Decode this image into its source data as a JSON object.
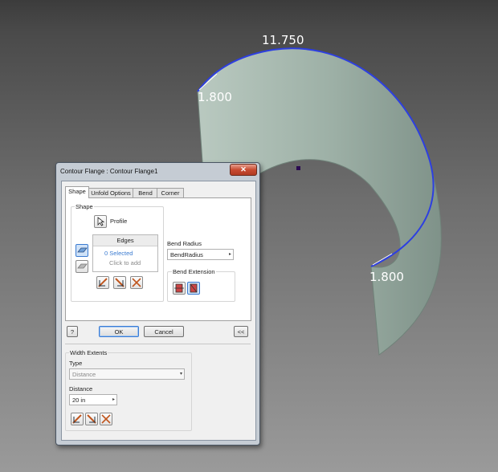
{
  "viewport": {
    "dimension_top": "11.750",
    "dimension_left": "1.800",
    "dimension_right": "1.800"
  },
  "dialog": {
    "title": "Contour Flange : Contour Flange1",
    "close_glyph": "✕",
    "tabs": [
      "Shape",
      "Unfold Options",
      "Bend",
      "Corner"
    ],
    "shape_group_label": "Shape",
    "profile_label": "Profile",
    "edges_header": "Edges",
    "edges_selected": "0 Selected",
    "edges_hint": "Click to add",
    "bend_radius_label": "Bend Radius",
    "bend_radius_value": "BendRadius",
    "bend_extension_label": "Bend Extension",
    "help_glyph": "?",
    "ok_label": "OK",
    "cancel_label": "Cancel",
    "collapse_label": "<<",
    "width_extents_label": "Width Extents",
    "type_label": "Type",
    "type_value": "Distance",
    "distance_label": "Distance",
    "distance_value": "20 in",
    "colors": {
      "accent_blue": "#3b7bd1",
      "close_red": "#c94b30",
      "edge_highlight": "#2d3fe0",
      "sheet_fill": "#9fb2a8"
    },
    "icons": [
      "profile-cursor-icon",
      "edge-mode-icon",
      "loop-mode-icon",
      "flip-side-1-icon",
      "flip-side-2-icon",
      "symmetric-icon",
      "bend-extension-1-icon",
      "bend-extension-2-icon"
    ]
  }
}
